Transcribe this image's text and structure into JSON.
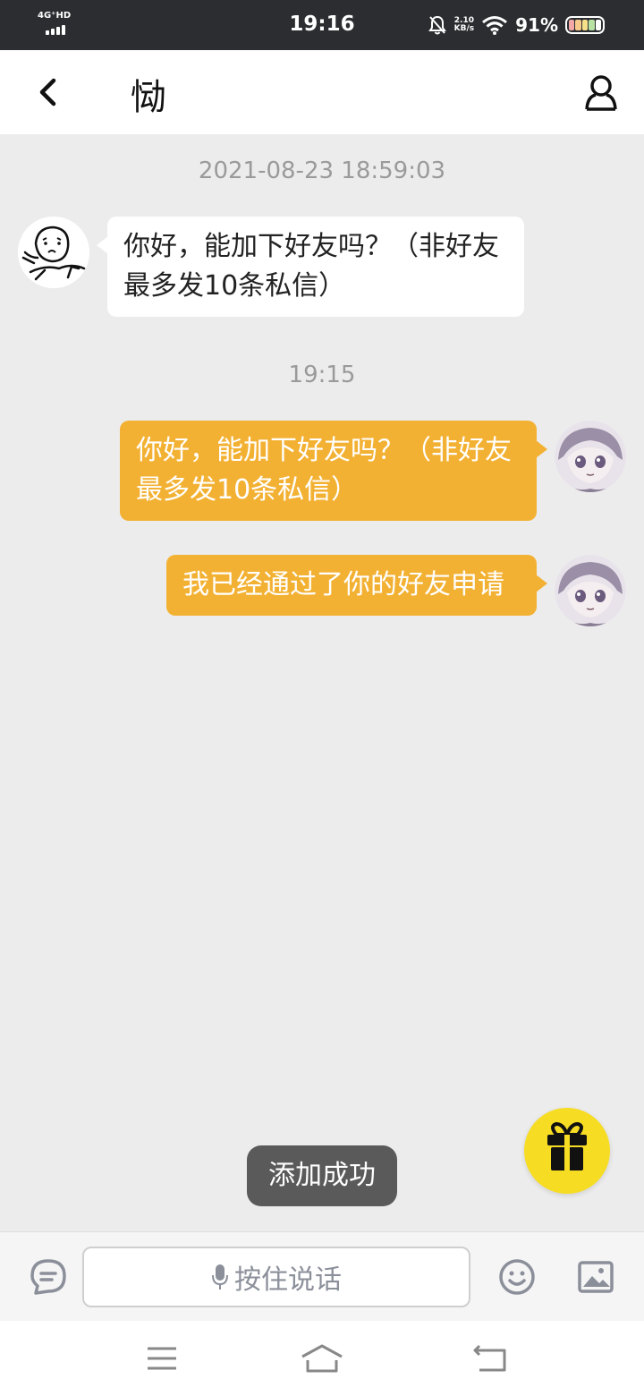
{
  "status_bar": {
    "network": "4G⁺HD",
    "time": "19:16",
    "speed_value": "2.10",
    "speed_unit": "KB/s",
    "battery": "91%"
  },
  "header": {
    "title": "恸",
    "back_icon": "chevron-left-icon",
    "profile_icon": "user-icon"
  },
  "messages": [
    {
      "type": "timestamp",
      "text": "2021-08-23 18:59:03"
    },
    {
      "type": "incoming",
      "text": "你好，能加下好友吗？（非好友最多发10条私信）"
    },
    {
      "type": "timestamp",
      "text": "19:15"
    },
    {
      "type": "outgoing",
      "text": "你好，能加下好友吗？（非好友最多发10条私信）"
    },
    {
      "type": "outgoing",
      "text": "我已经通过了你的好友申请"
    }
  ],
  "toast": "添加成功",
  "input_bar": {
    "voice_label": "按住说话",
    "left_icon": "message-bubble-icon",
    "emoji_icon": "emoji-icon",
    "image_icon": "image-icon"
  },
  "colors": {
    "outgoing_bubble": "#f3b133",
    "incoming_bubble": "#ffffff",
    "gift_button": "#f7dc24",
    "chat_background": "#ececec"
  }
}
